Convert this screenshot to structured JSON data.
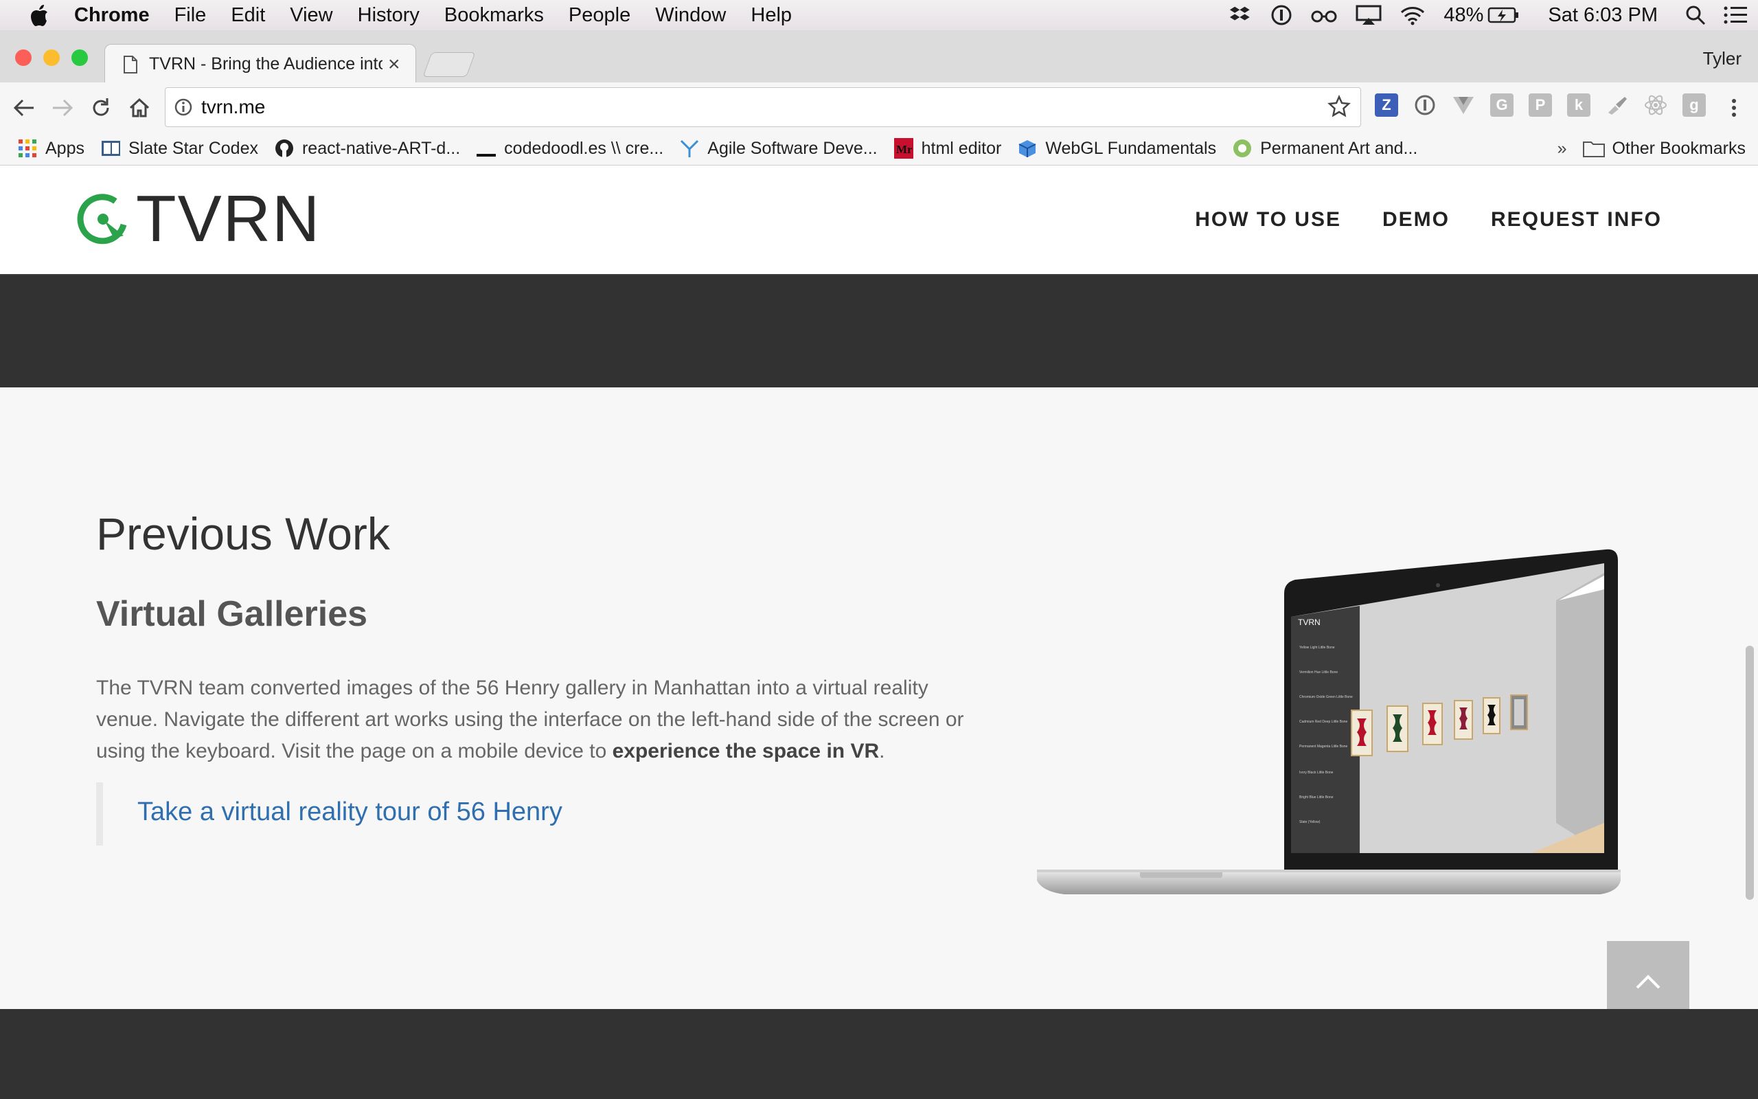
{
  "menubar": {
    "app": "Chrome",
    "items": [
      "File",
      "Edit",
      "View",
      "History",
      "Bookmarks",
      "People",
      "Window",
      "Help"
    ],
    "battery": "48%",
    "clock": "Sat 6:03 PM"
  },
  "browser": {
    "tab_title": "TVRN - Bring the Audience into",
    "profile": "Tyler",
    "url": "tvrn.me"
  },
  "bookmarks": {
    "items": [
      "Apps",
      "Slate Star Codex",
      "react-native-ART-d...",
      "codedoodl.es \\\\ cre...",
      "Agile Software Deve...",
      "html editor",
      "WebGL Fundamentals",
      "Permanent Art and..."
    ],
    "overflow": "»",
    "other": "Other Bookmarks"
  },
  "site": {
    "logo": "TVRN",
    "nav": [
      "HOW TO USE",
      "DEMO",
      "REQUEST INFO"
    ]
  },
  "section": {
    "heading": "Previous Work",
    "subheading": "Virtual Galleries",
    "para_start": "The TVRN team converted images of the 56 Henry gallery in Manhattan into a virtual reality venue. Navigate the different art works using the interface on the left-hand side of the screen or using the keyboard. Visit the page on a mobile device to ",
    "para_bold": "experience the space in VR",
    "para_end": ".",
    "link": "Take a virtual reality tour of 56 Henry"
  },
  "laptop_screen": {
    "logo": "TVRN",
    "menu": [
      "Yellow Light Little Bone",
      "Vermilion Hue Little Bone",
      "Chromium Oxide Green Little Bone",
      "Cadmium Red Deep Little Bone",
      "Permanent Magenta Little Bone",
      "Ivory Black Little Bone",
      "Bright Blue Little Bone",
      "Slate (Yellow)"
    ]
  },
  "colors": {
    "accent_green": "#2aa34a",
    "link_blue": "#2f6fb0",
    "dark_band": "#323232"
  }
}
